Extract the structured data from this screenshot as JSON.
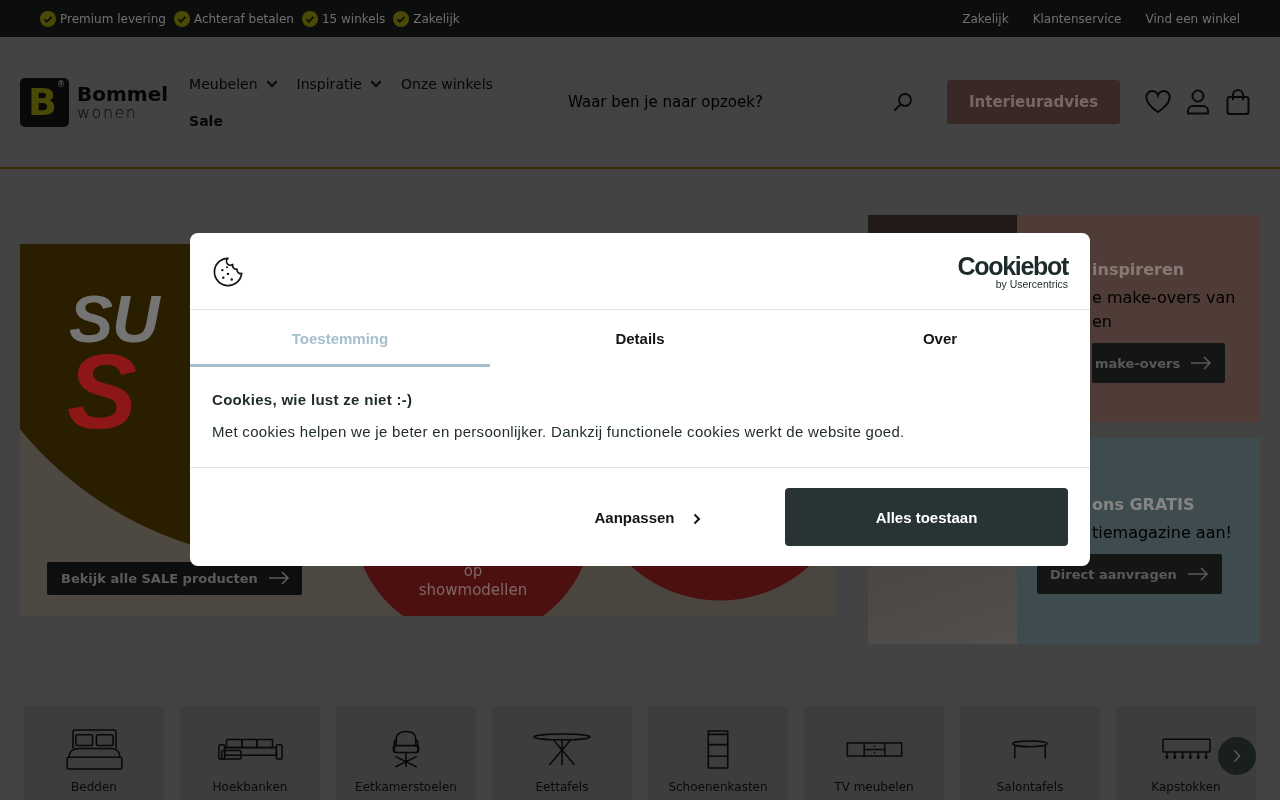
{
  "top_bar": {
    "usps": [
      "Premium levering",
      "Achteraf betalen",
      "15 winkels",
      "Zakelijk"
    ],
    "links": [
      "Zakelijk",
      "Klantenservice",
      "Vind een winkel"
    ]
  },
  "header": {
    "logo": {
      "mark": "B",
      "registered": "®",
      "name": "Bommel",
      "tagline": "wonen"
    },
    "nav": [
      {
        "label": "Meubelen",
        "dropdown": true,
        "highlight": false
      },
      {
        "label": "Inspiratie",
        "dropdown": true,
        "highlight": false
      },
      {
        "label": "Onze winkels",
        "dropdown": false,
        "highlight": false
      },
      {
        "label": "Sale",
        "dropdown": false,
        "highlight": true
      }
    ],
    "search": {
      "placeholder": "Waar ben je naar opzoek?"
    },
    "advice_button": "Interieuradvies"
  },
  "hero": {
    "title_top": "SU",
    "title_bottom": "S",
    "badge_lines": [
      "op",
      "showmodellen"
    ],
    "button": "Bekijk alle SALE producten"
  },
  "promos": [
    {
      "title": "inspireren",
      "text_lines": [
        "e make-overs van",
        "en"
      ],
      "button": "make-overs"
    },
    {
      "title": "ons GRATIS",
      "text_lines": [
        "tiemagazine aan!"
      ],
      "button": "Direct aanvragen"
    }
  ],
  "categories": [
    {
      "label": "Bedden",
      "kind": "bed"
    },
    {
      "label": "Hoekbanken",
      "kind": "sofa"
    },
    {
      "label": "Eetkamerstoelen",
      "kind": "chair"
    },
    {
      "label": "Eettafels",
      "kind": "table"
    },
    {
      "label": "Schoenenkasten",
      "kind": "cabinet"
    },
    {
      "label": "TV meubelen",
      "kind": "tvstand"
    },
    {
      "label": "Salontafels",
      "kind": "coffeetable"
    },
    {
      "label": "Kapstokken",
      "kind": "coatrack"
    }
  ],
  "cookie_dialog": {
    "brand": "Cookiebot",
    "brand_sub": "by Usercentrics",
    "tabs": [
      {
        "label": "Toestemming",
        "selected": true
      },
      {
        "label": "Details",
        "selected": false
      },
      {
        "label": "Over",
        "selected": false
      }
    ],
    "title": "Cookies, wie lust ze niet :-)",
    "text": "Met cookies helpen we je beter en persoonlijker. Dankzij functionele cookies werkt de website goed.",
    "customize_button": "Aanpassen",
    "accept_button": "Alles toestaan"
  }
}
